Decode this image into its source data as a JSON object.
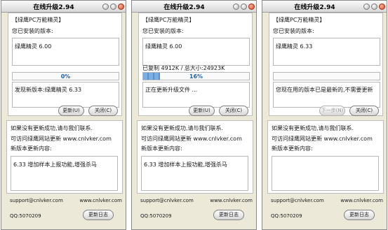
{
  "windows": [
    {
      "title": "在线升级2.94",
      "group_title": "【绿鹰PC万能精灵】",
      "installed_label": "您已安装的版本:",
      "installed_version": "绿鹰精灵 6.00",
      "copied_text": "",
      "progress_percent": 0,
      "progress_text": "0%",
      "message": "发现新版本:绿鹰精灵 6.33",
      "primary_button": "更新(U)",
      "primary_enabled": true,
      "close_button": "关闭(C)",
      "help_line1": "如果没有更新成功,请与我们联系.",
      "help_line2": "可访问绿鹰网站更新 www.cnlvker.com",
      "new_content_label": "新版本更新内容:",
      "new_content": "6.33 增加样本上报功能,增强杀马",
      "email": "support@cnlvker.com",
      "site": "www.cnlvker.com",
      "qq": "QQ:5070209",
      "log_button": "更新日志"
    },
    {
      "title": "在线升级2.94",
      "group_title": "【绿鹰PC万能精灵】",
      "installed_label": "您已安装的版本:",
      "installed_version": "绿鹰精灵 6.00",
      "copied_text": "已复制 4912K / 总大小:24923K",
      "progress_percent": 16,
      "progress_text": "16%",
      "message": "正在更新升级文件 ...",
      "primary_button": "更新(U)",
      "primary_enabled": true,
      "close_button": "关闭(C)",
      "help_line1": "如果没有更新成功,请与我们联系.",
      "help_line2": "可访问绿鹰网站更新 www.cnlvker.com",
      "new_content_label": "新版本更新内容:",
      "new_content": "6.33 增加样本上报功能,增强杀马",
      "email": "support@cnlvker.com",
      "site": "www.cnlvker.com",
      "qq": "QQ:5070209",
      "log_button": "更新日志"
    },
    {
      "title": "在线升级2.94",
      "group_title": "【绿鹰PC万能精灵】",
      "installed_label": "您已安装的版本:",
      "installed_version": "绿鹰精灵 6.33",
      "copied_text": "",
      "progress_percent": 0,
      "progress_text": "",
      "message": "您现在用的版本已是最新的,不需要更新",
      "primary_button": "下一步(N)",
      "primary_enabled": false,
      "close_button": "关闭(C)",
      "help_line1": "如果没有更新成功,请与我们联系.",
      "help_line2": "可访问绿鹰网站更新 www.cnlvker.com",
      "new_content_label": "新版本更新内容:",
      "new_content": "",
      "email": "support@cnlvker.com",
      "site": "www.cnlvker.com",
      "qq": "QQ:5070209",
      "log_button": "更新日志"
    }
  ]
}
